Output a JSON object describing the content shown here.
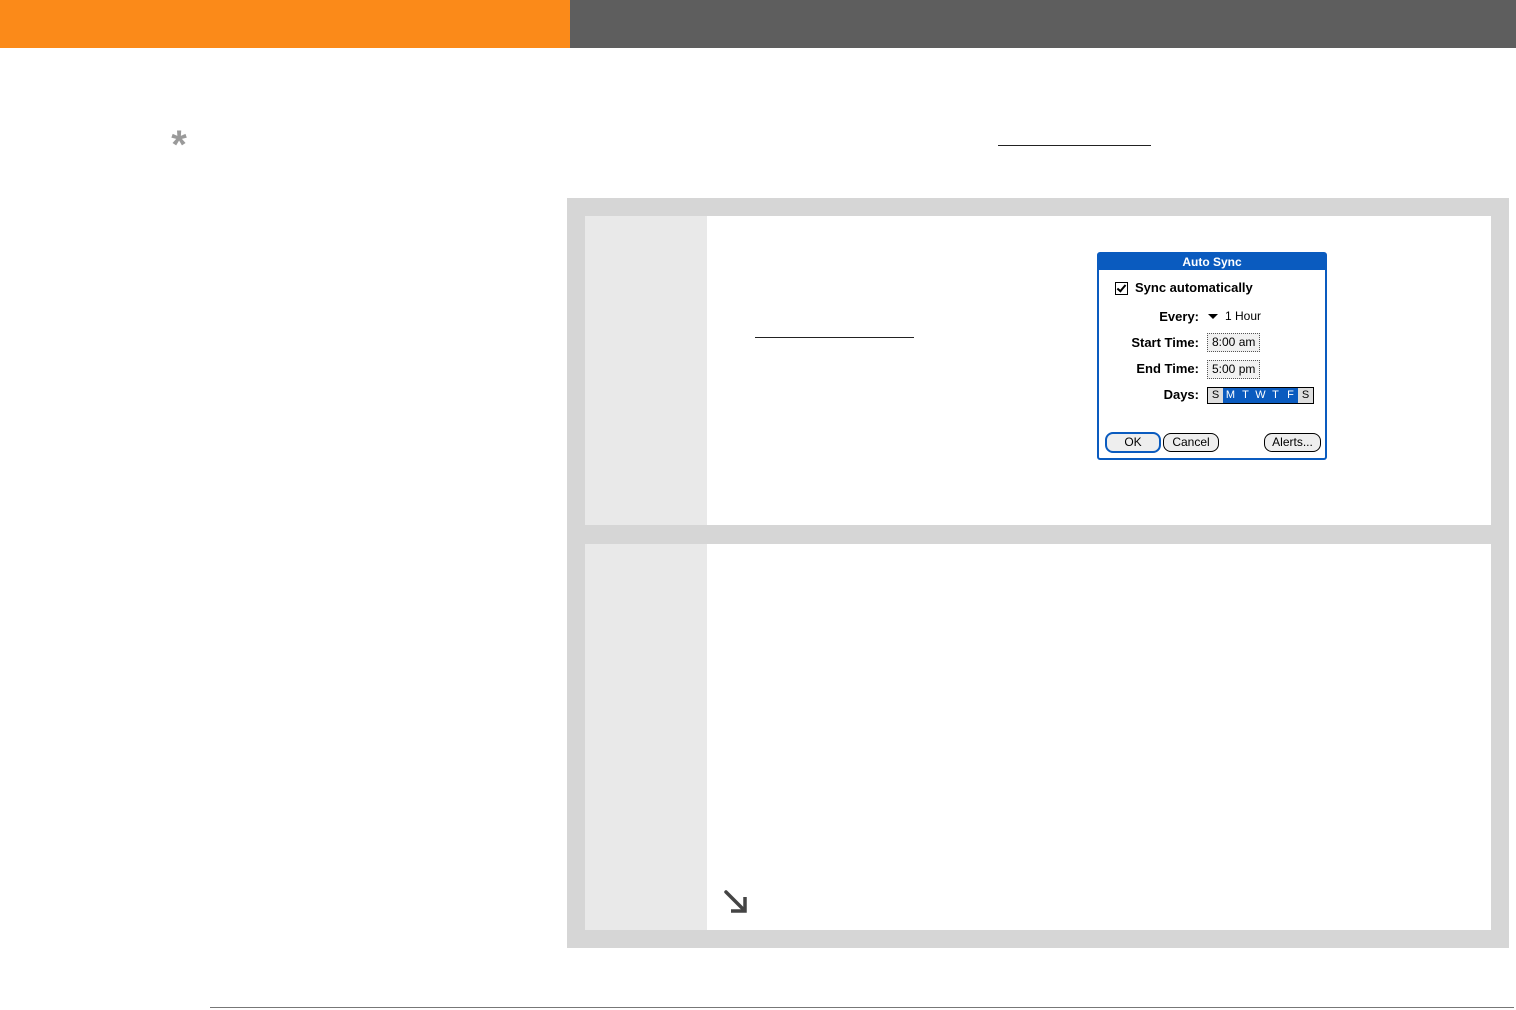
{
  "tip": {
    "icon": "asterisk-icon"
  },
  "continue": {
    "icon": "arrow-down-right-icon"
  },
  "dialog": {
    "title": "Auto Sync",
    "sync_checkbox_label": "Sync automatically",
    "sync_checked": true,
    "every_label": "Every:",
    "every_value": "1 Hour",
    "start_label": "Start Time:",
    "start_value": "8:00 am",
    "end_label": "End Time:",
    "end_value": "5:00 pm",
    "days_label": "Days:",
    "days": [
      "S",
      "M",
      "T",
      "W",
      "T",
      "F",
      "S"
    ],
    "ok_label": "OK",
    "cancel_label": "Cancel",
    "alerts_label": "Alerts..."
  },
  "colors": {
    "header_orange": "#fb8a19",
    "header_gray": "#5e5e5e",
    "palm_blue": "#0a5bbf"
  }
}
